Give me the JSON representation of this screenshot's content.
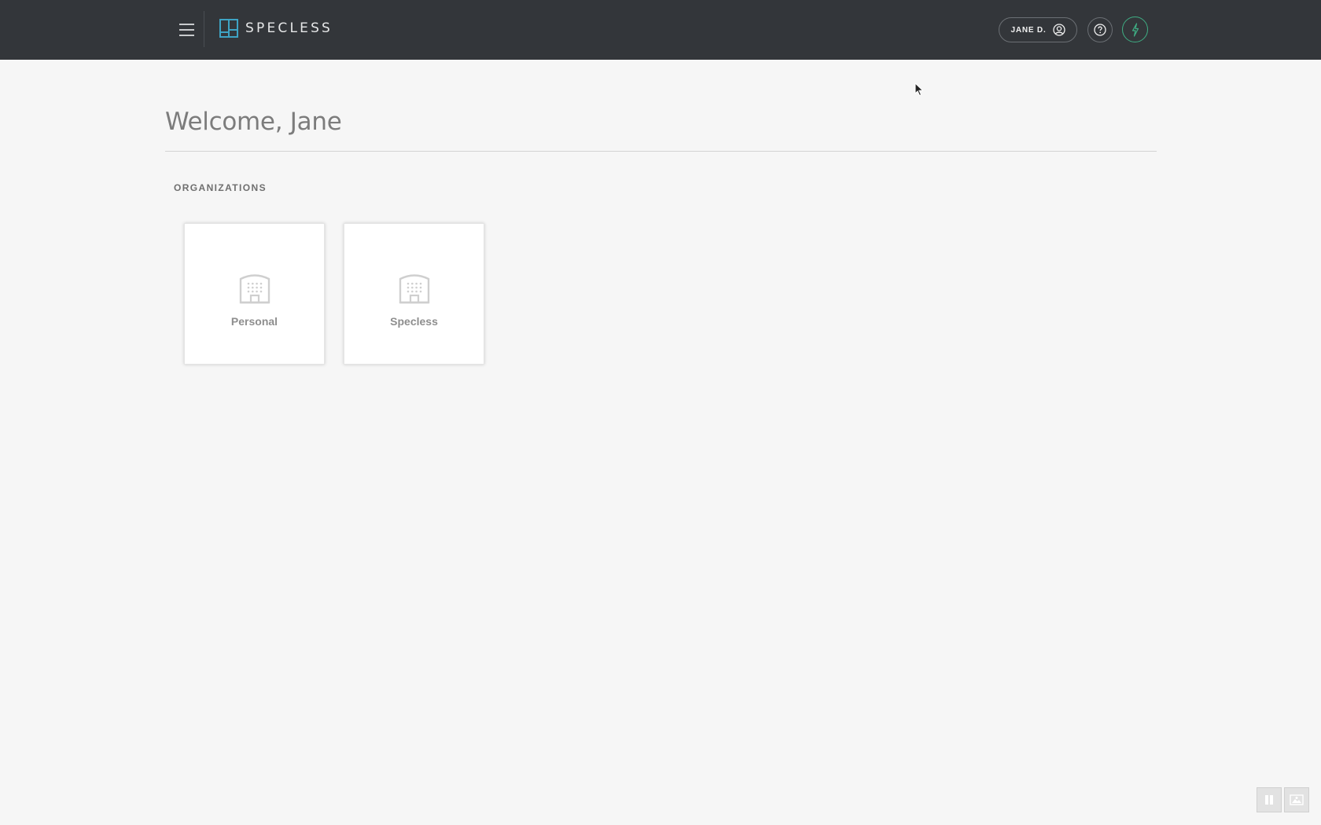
{
  "header": {
    "brand": "SPECLESS",
    "user_label": "JANE D.",
    "colors": {
      "bar": "#33363a",
      "logo": "#3ea3c4",
      "power": "#3fae84"
    },
    "icons": [
      "menu-icon",
      "logo-icon",
      "user-circle-icon",
      "help-icon",
      "power-icon"
    ]
  },
  "main": {
    "greeting": "Welcome, Jane",
    "section_title": "ORGANIZATIONS",
    "organizations": [
      {
        "name": "Personal",
        "icon": "building-icon"
      },
      {
        "name": "Specless",
        "icon": "building-icon"
      }
    ]
  },
  "controls": {
    "icons": [
      "pause-icon",
      "image-icon"
    ]
  }
}
